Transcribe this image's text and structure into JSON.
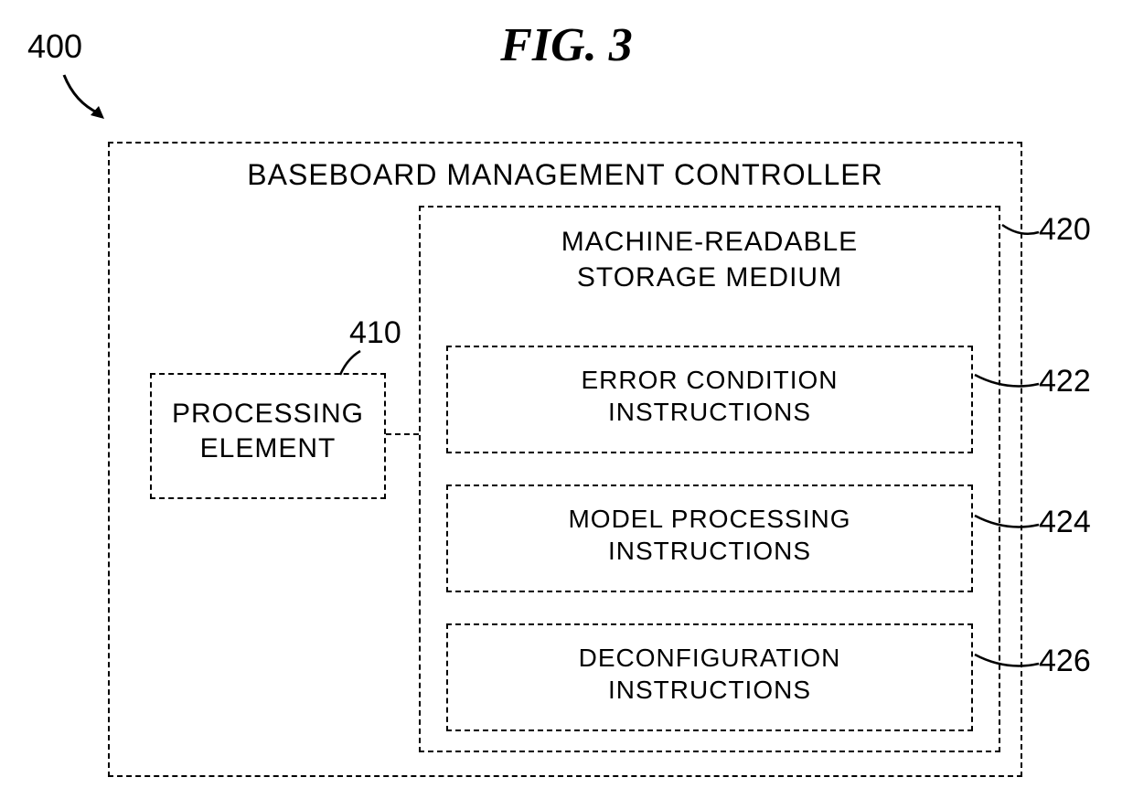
{
  "figure": {
    "title": "FIG. 3",
    "overall_ref": "400"
  },
  "blocks": {
    "main": {
      "label": "BASEBOARD MANAGEMENT CONTROLLER"
    },
    "processing": {
      "label_line1": "PROCESSING",
      "label_line2": "ELEMENT",
      "ref": "410"
    },
    "storage": {
      "label_line1": "MACHINE-READABLE",
      "label_line2": "STORAGE MEDIUM",
      "ref": "420"
    },
    "instruction_blocks": [
      {
        "line1": "ERROR CONDITION",
        "line2": "INSTRUCTIONS",
        "ref": "422"
      },
      {
        "line1": "MODEL PROCESSING",
        "line2": "INSTRUCTIONS",
        "ref": "424"
      },
      {
        "line1": "DECONFIGURATION",
        "line2": "INSTRUCTIONS",
        "ref": "426"
      }
    ]
  }
}
